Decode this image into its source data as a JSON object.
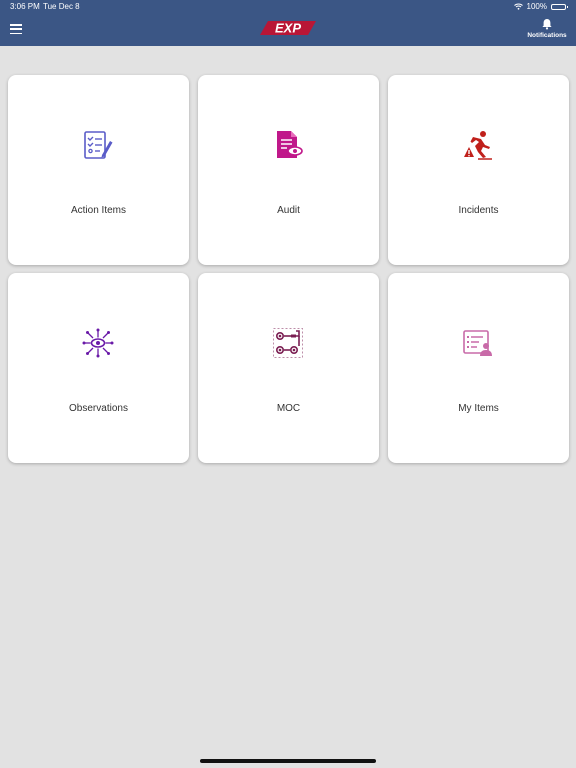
{
  "status_bar": {
    "time": "3:06 PM",
    "date": "Tue Dec 8",
    "battery": "100%"
  },
  "header": {
    "logo_text": "EXP",
    "notifications_label": "Notifications"
  },
  "tiles": [
    {
      "label": "Action Items",
      "icon": "checklist-icon",
      "color": "#5a5cc8"
    },
    {
      "label": "Audit",
      "icon": "document-eye-icon",
      "color": "#c0188a"
    },
    {
      "label": "Incidents",
      "icon": "slip-fall-warning-icon",
      "color": "#c0201b"
    },
    {
      "label": "Observations",
      "icon": "eye-radiating-arrows-icon",
      "color": "#6a1aa8"
    },
    {
      "label": "MOC",
      "icon": "gears-flow-icon",
      "color": "#7a1e52"
    },
    {
      "label": "My Items",
      "icon": "list-person-icon",
      "color": "#c86aa8"
    }
  ]
}
